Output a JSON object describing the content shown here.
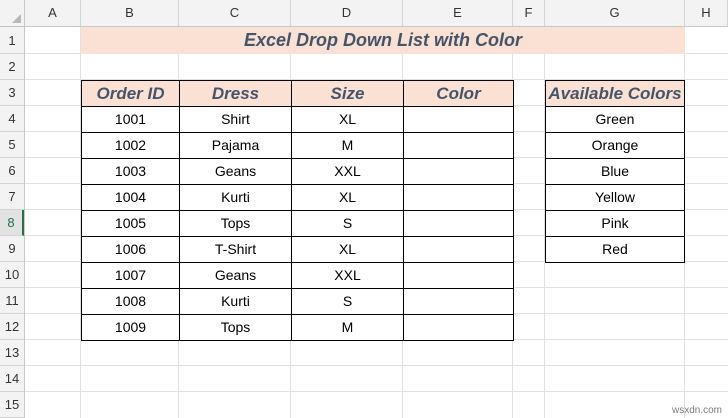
{
  "columns": [
    "A",
    "B",
    "C",
    "D",
    "E",
    "F",
    "G",
    "H"
  ],
  "rows": [
    "1",
    "2",
    "3",
    "4",
    "5",
    "6",
    "7",
    "8",
    "9",
    "10",
    "11",
    "12",
    "13",
    "14",
    "15"
  ],
  "active_row": "8",
  "title": "Excel Drop Down List with Color",
  "orders_table": {
    "headers": [
      "Order ID",
      "Dress",
      "Size",
      "Color"
    ],
    "rows": [
      [
        "1001",
        "Shirt",
        "XL",
        ""
      ],
      [
        "1002",
        "Pajama",
        "M",
        ""
      ],
      [
        "1003",
        "Geans",
        "XXL",
        ""
      ],
      [
        "1004",
        "Kurti",
        "XL",
        ""
      ],
      [
        "1005",
        "Tops",
        "S",
        ""
      ],
      [
        "1006",
        "T-Shirt",
        "XL",
        ""
      ],
      [
        "1007",
        "Geans",
        "XXL",
        ""
      ],
      [
        "1008",
        "Kurti",
        "S",
        ""
      ],
      [
        "1009",
        "Tops",
        "M",
        ""
      ]
    ]
  },
  "colors_table": {
    "header": "Available Colors",
    "items": [
      "Green",
      "Orange",
      "Blue",
      "Yellow",
      "Pink",
      "Red"
    ]
  },
  "watermark": "wsxdn.com",
  "theme": {
    "header_fill": "#fbe1d4",
    "header_text": "#44546a",
    "active_row_accent": "#217346"
  }
}
